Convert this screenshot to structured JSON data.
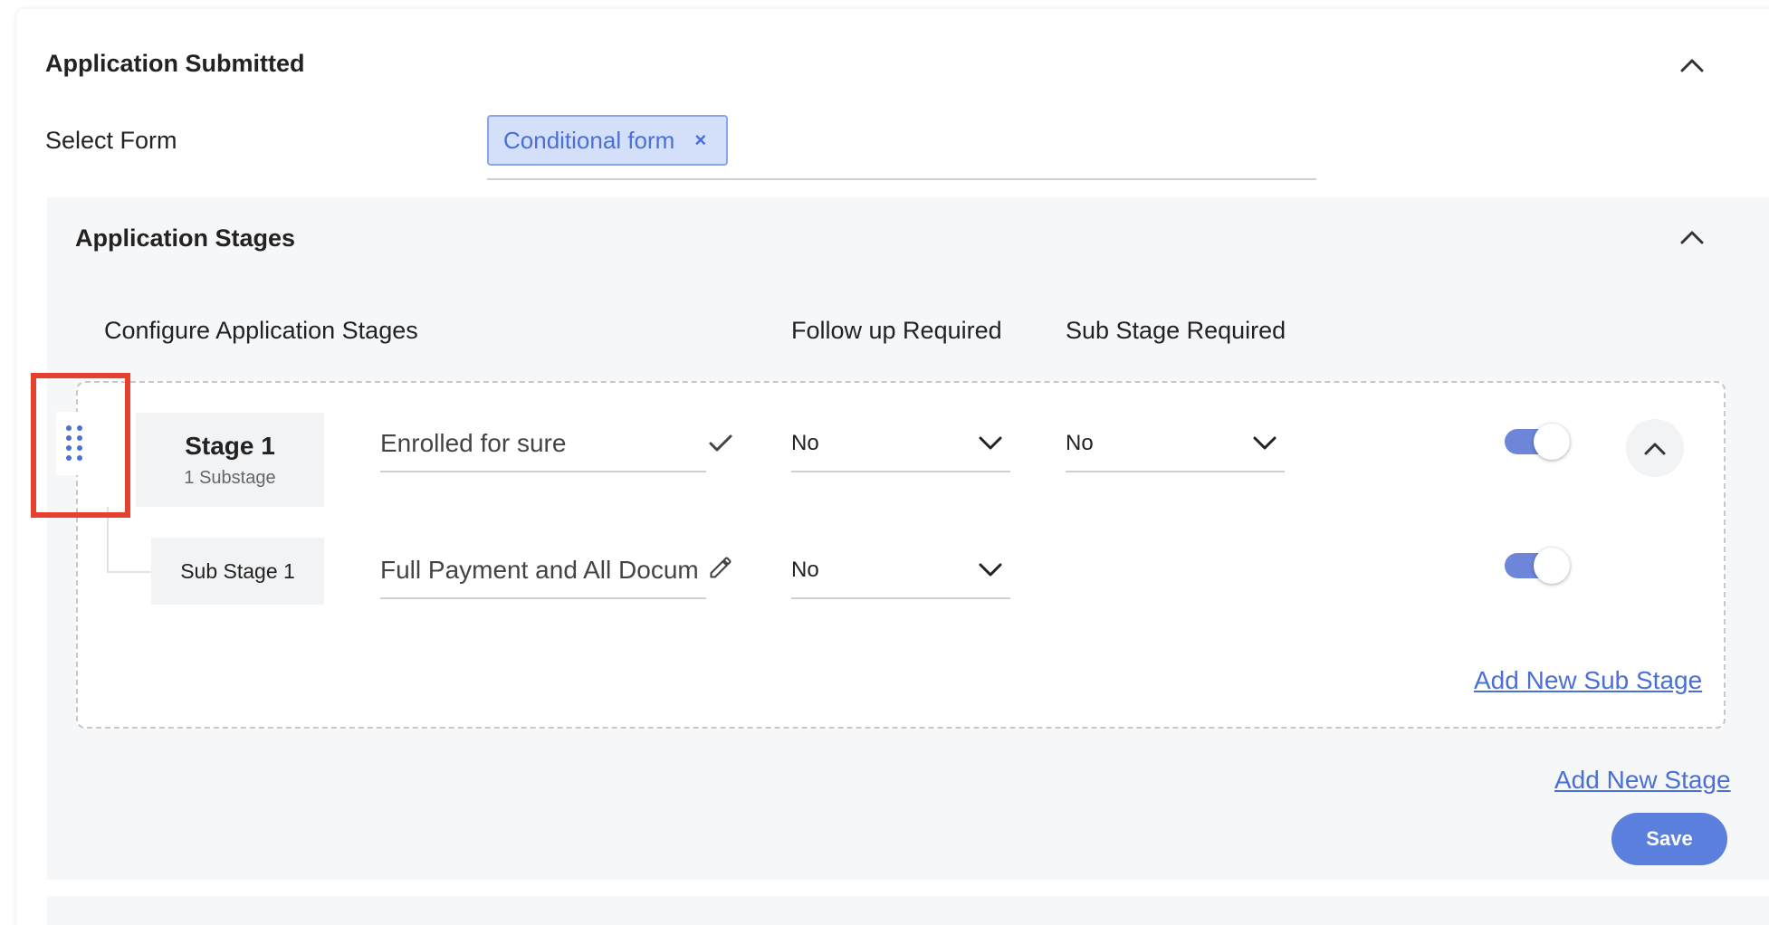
{
  "section": {
    "title": "Application Submitted",
    "select_form_label": "Select Form",
    "selected_form_chip": "Conditional form",
    "chip_remove_glyph": "×"
  },
  "stages_panel": {
    "title": "Application Stages",
    "column_headers": {
      "configure": "Configure Application Stages",
      "follow_up": "Follow up Required",
      "sub_stage": "Sub Stage Required"
    },
    "stage": {
      "name": "Stage 1",
      "substage_count": "1 Substage",
      "label_value": "Enrolled for sure",
      "follow_up_value": "No",
      "sub_stage_required_value": "No",
      "enabled": true
    },
    "substage": {
      "name": "Sub Stage 1",
      "label_value": "Full Payment and All Docum",
      "follow_up_value": "No",
      "enabled": true
    },
    "add_sub_stage_link": "Add New Sub Stage",
    "add_stage_link": "Add New Stage",
    "save_label": "Save"
  },
  "colors": {
    "accent": "#5b7fdc",
    "toggle_on": "#6d86d9",
    "chip_bg": "#d4dffa",
    "highlight": "#e6402f"
  },
  "icons": {
    "collapse": "chevron-up-icon",
    "drag": "drag-handle-icon",
    "confirm": "check-icon",
    "edit": "pencil-icon",
    "dropdown": "chevron-down-icon"
  }
}
